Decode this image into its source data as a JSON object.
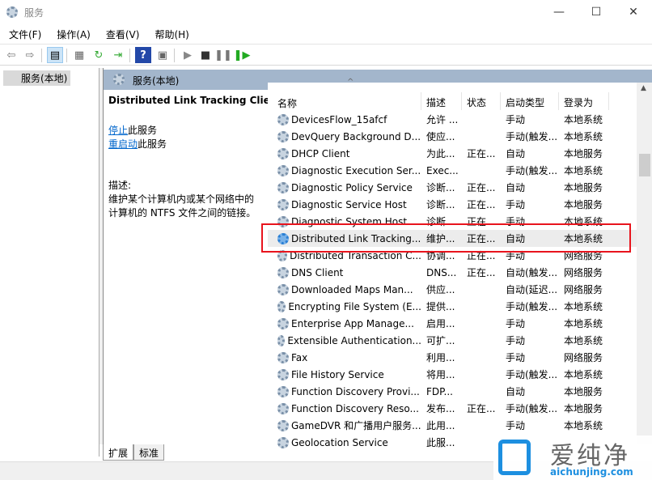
{
  "window": {
    "title": "服务",
    "icon": "gear-icon"
  },
  "menu": [
    "文件(F)",
    "操作(A)",
    "查看(V)",
    "帮助(H)"
  ],
  "toolbar": [
    "back-icon",
    "forward-icon",
    "show-console-tree-icon",
    "properties-icon",
    "refresh-icon",
    "export-list-icon",
    "help-icon",
    "action-pane-icon",
    "start-icon",
    "stop-icon",
    "pause-icon",
    "restart-icon"
  ],
  "tree": {
    "item": "服务(本地)"
  },
  "panel": {
    "title": "服务(本地)"
  },
  "detail": {
    "name": "Distributed Link Tracking Client",
    "stop_link": "停止",
    "stop_rest": "此服务",
    "restart_link": "重启动",
    "restart_rest": "此服务",
    "desc_label": "描述:",
    "desc": "维护某个计算机内或某个网络中的计算机的 NTFS 文件之间的链接。"
  },
  "columns": [
    "名称",
    "描述",
    "状态",
    "启动类型",
    "登录为"
  ],
  "rows": [
    [
      "DevicesFlow_15afcf",
      "允许 ...",
      "",
      "手动",
      "本地系统"
    ],
    [
      "DevQuery Background D...",
      "使应...",
      "",
      "手动(触发...",
      "本地系统"
    ],
    [
      "DHCP Client",
      "为此...",
      "正在...",
      "自动",
      "本地服务"
    ],
    [
      "Diagnostic Execution Ser...",
      "Exec...",
      "",
      "手动(触发...",
      "本地系统"
    ],
    [
      "Diagnostic Policy Service",
      "诊断...",
      "正在...",
      "自动",
      "本地服务"
    ],
    [
      "Diagnostic Service Host",
      "诊断...",
      "正在...",
      "手动",
      "本地服务"
    ],
    [
      "Diagnostic System Host",
      "诊断...",
      "正在...",
      "手动",
      "本地系统"
    ],
    [
      "Distributed Link Tracking...",
      "维护...",
      "正在...",
      "自动",
      "本地系统"
    ],
    [
      "Distributed Transaction C...",
      "协调...",
      "正在...",
      "手动",
      "网络服务"
    ],
    [
      "DNS Client",
      "DNS...",
      "正在...",
      "自动(触发...",
      "网络服务"
    ],
    [
      "Downloaded Maps Man...",
      "供应...",
      "",
      "自动(延迟...",
      "网络服务"
    ],
    [
      "Encrypting File System (E...",
      "提供...",
      "",
      "手动(触发...",
      "本地系统"
    ],
    [
      "Enterprise App Manage...",
      "启用...",
      "",
      "手动",
      "本地系统"
    ],
    [
      "Extensible Authentication...",
      "可扩...",
      "",
      "手动",
      "本地系统"
    ],
    [
      "Fax",
      "利用...",
      "",
      "手动",
      "网络服务"
    ],
    [
      "File History Service",
      "将用...",
      "",
      "手动(触发...",
      "本地系统"
    ],
    [
      "Function Discovery Provi...",
      "FDP...",
      "",
      "自动",
      "本地服务"
    ],
    [
      "Function Discovery Reso...",
      "发布...",
      "正在...",
      "手动(触发...",
      "本地服务"
    ],
    [
      "GameDVR 和广播用户服务...",
      "此用...",
      "",
      "手动",
      "本地系统"
    ],
    [
      "Geolocation Service",
      "此服...",
      "",
      "",
      ""
    ]
  ],
  "selected_row": 7,
  "tabs": [
    "扩展",
    "标准"
  ],
  "active_tab": 0,
  "watermark": {
    "name": "爱纯净",
    "url": "aichunjing.com"
  },
  "colors": {
    "highlight_box": "#e8141d",
    "panel_header": "#a3b6cc",
    "link": "#0066cc"
  }
}
